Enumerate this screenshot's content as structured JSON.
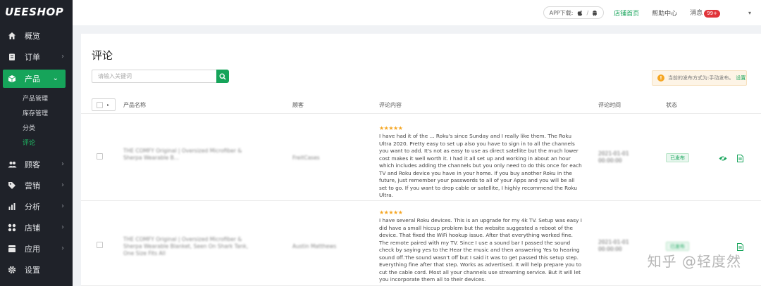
{
  "sidebar": {
    "logo": "UEESHOP",
    "items": [
      {
        "label": "概览",
        "icon": "home-icon"
      },
      {
        "label": "订单",
        "icon": "clipboard-icon"
      },
      {
        "label": "产品",
        "icon": "box-icon"
      },
      {
        "label": "顾客",
        "icon": "users-icon"
      },
      {
        "label": "营销",
        "icon": "tag-icon"
      },
      {
        "label": "分析",
        "icon": "bar-chart-icon"
      },
      {
        "label": "店铺",
        "icon": "grid-icon"
      },
      {
        "label": "应用",
        "icon": "apps-icon"
      },
      {
        "label": "设置",
        "icon": "gear-icon"
      }
    ],
    "submenu": [
      "产品管理",
      "库存管理",
      "分类",
      "评论"
    ]
  },
  "topbar": {
    "app_download": "APP下载:",
    "store_home": "店铺首页",
    "help_center": "帮助中心",
    "messages": "消息",
    "messages_badge": "99+"
  },
  "page": {
    "title": "评论",
    "search_placeholder": "请输入关键词",
    "notice_text": "当前的发布方式为:手动发布。",
    "notice_link": "设置"
  },
  "table": {
    "columns": [
      "产品名称",
      "顾客",
      "评论内容",
      "评论时间",
      "状态"
    ],
    "rows": [
      {
        "product": "THE COMFY Original | Oversized Microfiber & Sherpa Wearable B...",
        "customer": "FreitCases",
        "stars": "★★★★★",
        "review": "I have had it of the ... Roku's since Sunday and I really like them. The Roku Ultra 2020. Pretty easy to set up also you have to sign in to all the channels you want to add. It's not as easy to use as direct satellite but the much lower cost makes it well worth it. I had it all set up and working in about an hour which includes adding the channels but you only need to do this once for each TV and Roku device you have in your home. If you buy another Roku in the future, just remember your passwords to all of your Apps and you will be all set to go. If you want to drop cable or satellite, I highly recommend the Roku Ultra.",
        "time": "2021-01-01 00:00:00",
        "status": "已发布"
      },
      {
        "product": "THE COMFY Original | Oversized Microfiber & Sherpa Wearable Blanket, Seen On Shark Tank, One Size Fits All",
        "customer": "Austin Matthews",
        "stars": "★★★★★",
        "review": "I have several Roku devices. This is an upgrade for my 4k TV. Setup was easy I did have a small hiccup problem but the website suggested a reboot of the device. That fixed the WiFi hookup issue. After that everything worked fine. The remote paired with my TV. Since I use a sound bar I passed the sound check by saying yes to the Hear the music and then answering Yes to hearing sound off.The sound wasn't off but I said it was to get passed this setup step. Everything fine after that step. Works as advertised. It will help prepare you to cut the cable cord. Most all your channels use streaming service. But it will let you incorporate them all to their devices.",
        "time": "2021-01-01 00:00:00",
        "status": "已发布"
      }
    ]
  },
  "watermark": "知乎 @轻度然",
  "colors": {
    "accent": "#16a45a",
    "sidebar": "#1f2229",
    "badge": "#e0343a"
  }
}
